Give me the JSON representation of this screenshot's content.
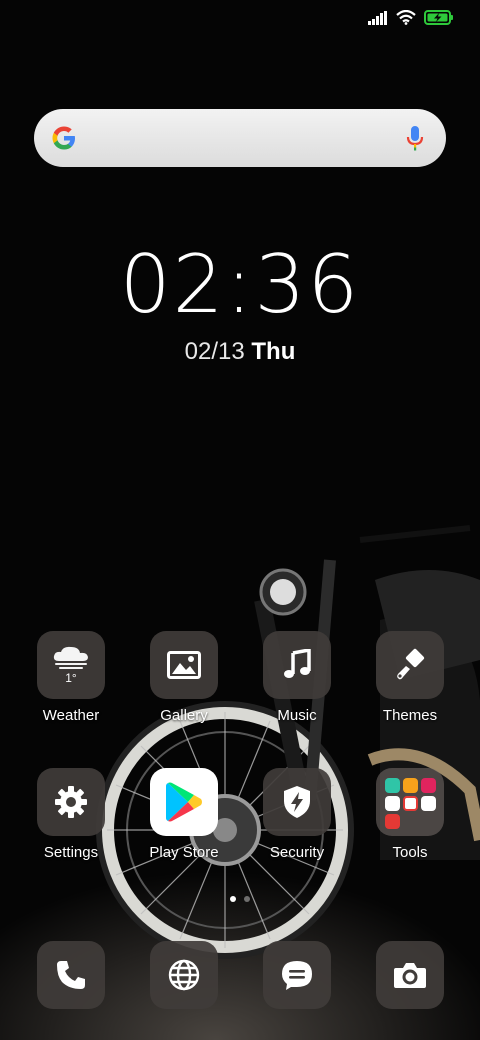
{
  "status_bar": {
    "signal_icon": "signal-bars-icon",
    "wifi_icon": "wifi-icon",
    "battery_icon": "battery-charging-icon",
    "battery_color": "#2ec93b"
  },
  "search": {
    "logo_icon": "google-g-icon",
    "mic_icon": "microphone-icon",
    "placeholder": ""
  },
  "clock": {
    "time": "02:36",
    "date": "02/13",
    "day": "Thu"
  },
  "apps": {
    "weather": {
      "label": "Weather",
      "temp": "1°",
      "icon": "cloud-icon"
    },
    "gallery": {
      "label": "Gallery",
      "icon": "image-icon"
    },
    "music": {
      "label": "Music",
      "icon": "music-note-icon"
    },
    "themes": {
      "label": "Themes",
      "icon": "paintbrush-icon"
    },
    "settings": {
      "label": "Settings",
      "icon": "gear-icon"
    },
    "playstore": {
      "label": "Play Store",
      "icon": "play-store-icon"
    },
    "security": {
      "label": "Security",
      "icon": "shield-bolt-icon"
    },
    "tools": {
      "label": "Tools",
      "icon": "folder-icon"
    }
  },
  "pages": {
    "count": 2,
    "active": 1
  },
  "dock": {
    "phone": "phone-icon",
    "browser": "globe-icon",
    "messages": "message-icon",
    "camera": "camera-icon"
  },
  "colors": {
    "background": "#050505",
    "tile": "#403c3a",
    "accent_red": "#e53935",
    "accent_green": "#2ec93b"
  }
}
